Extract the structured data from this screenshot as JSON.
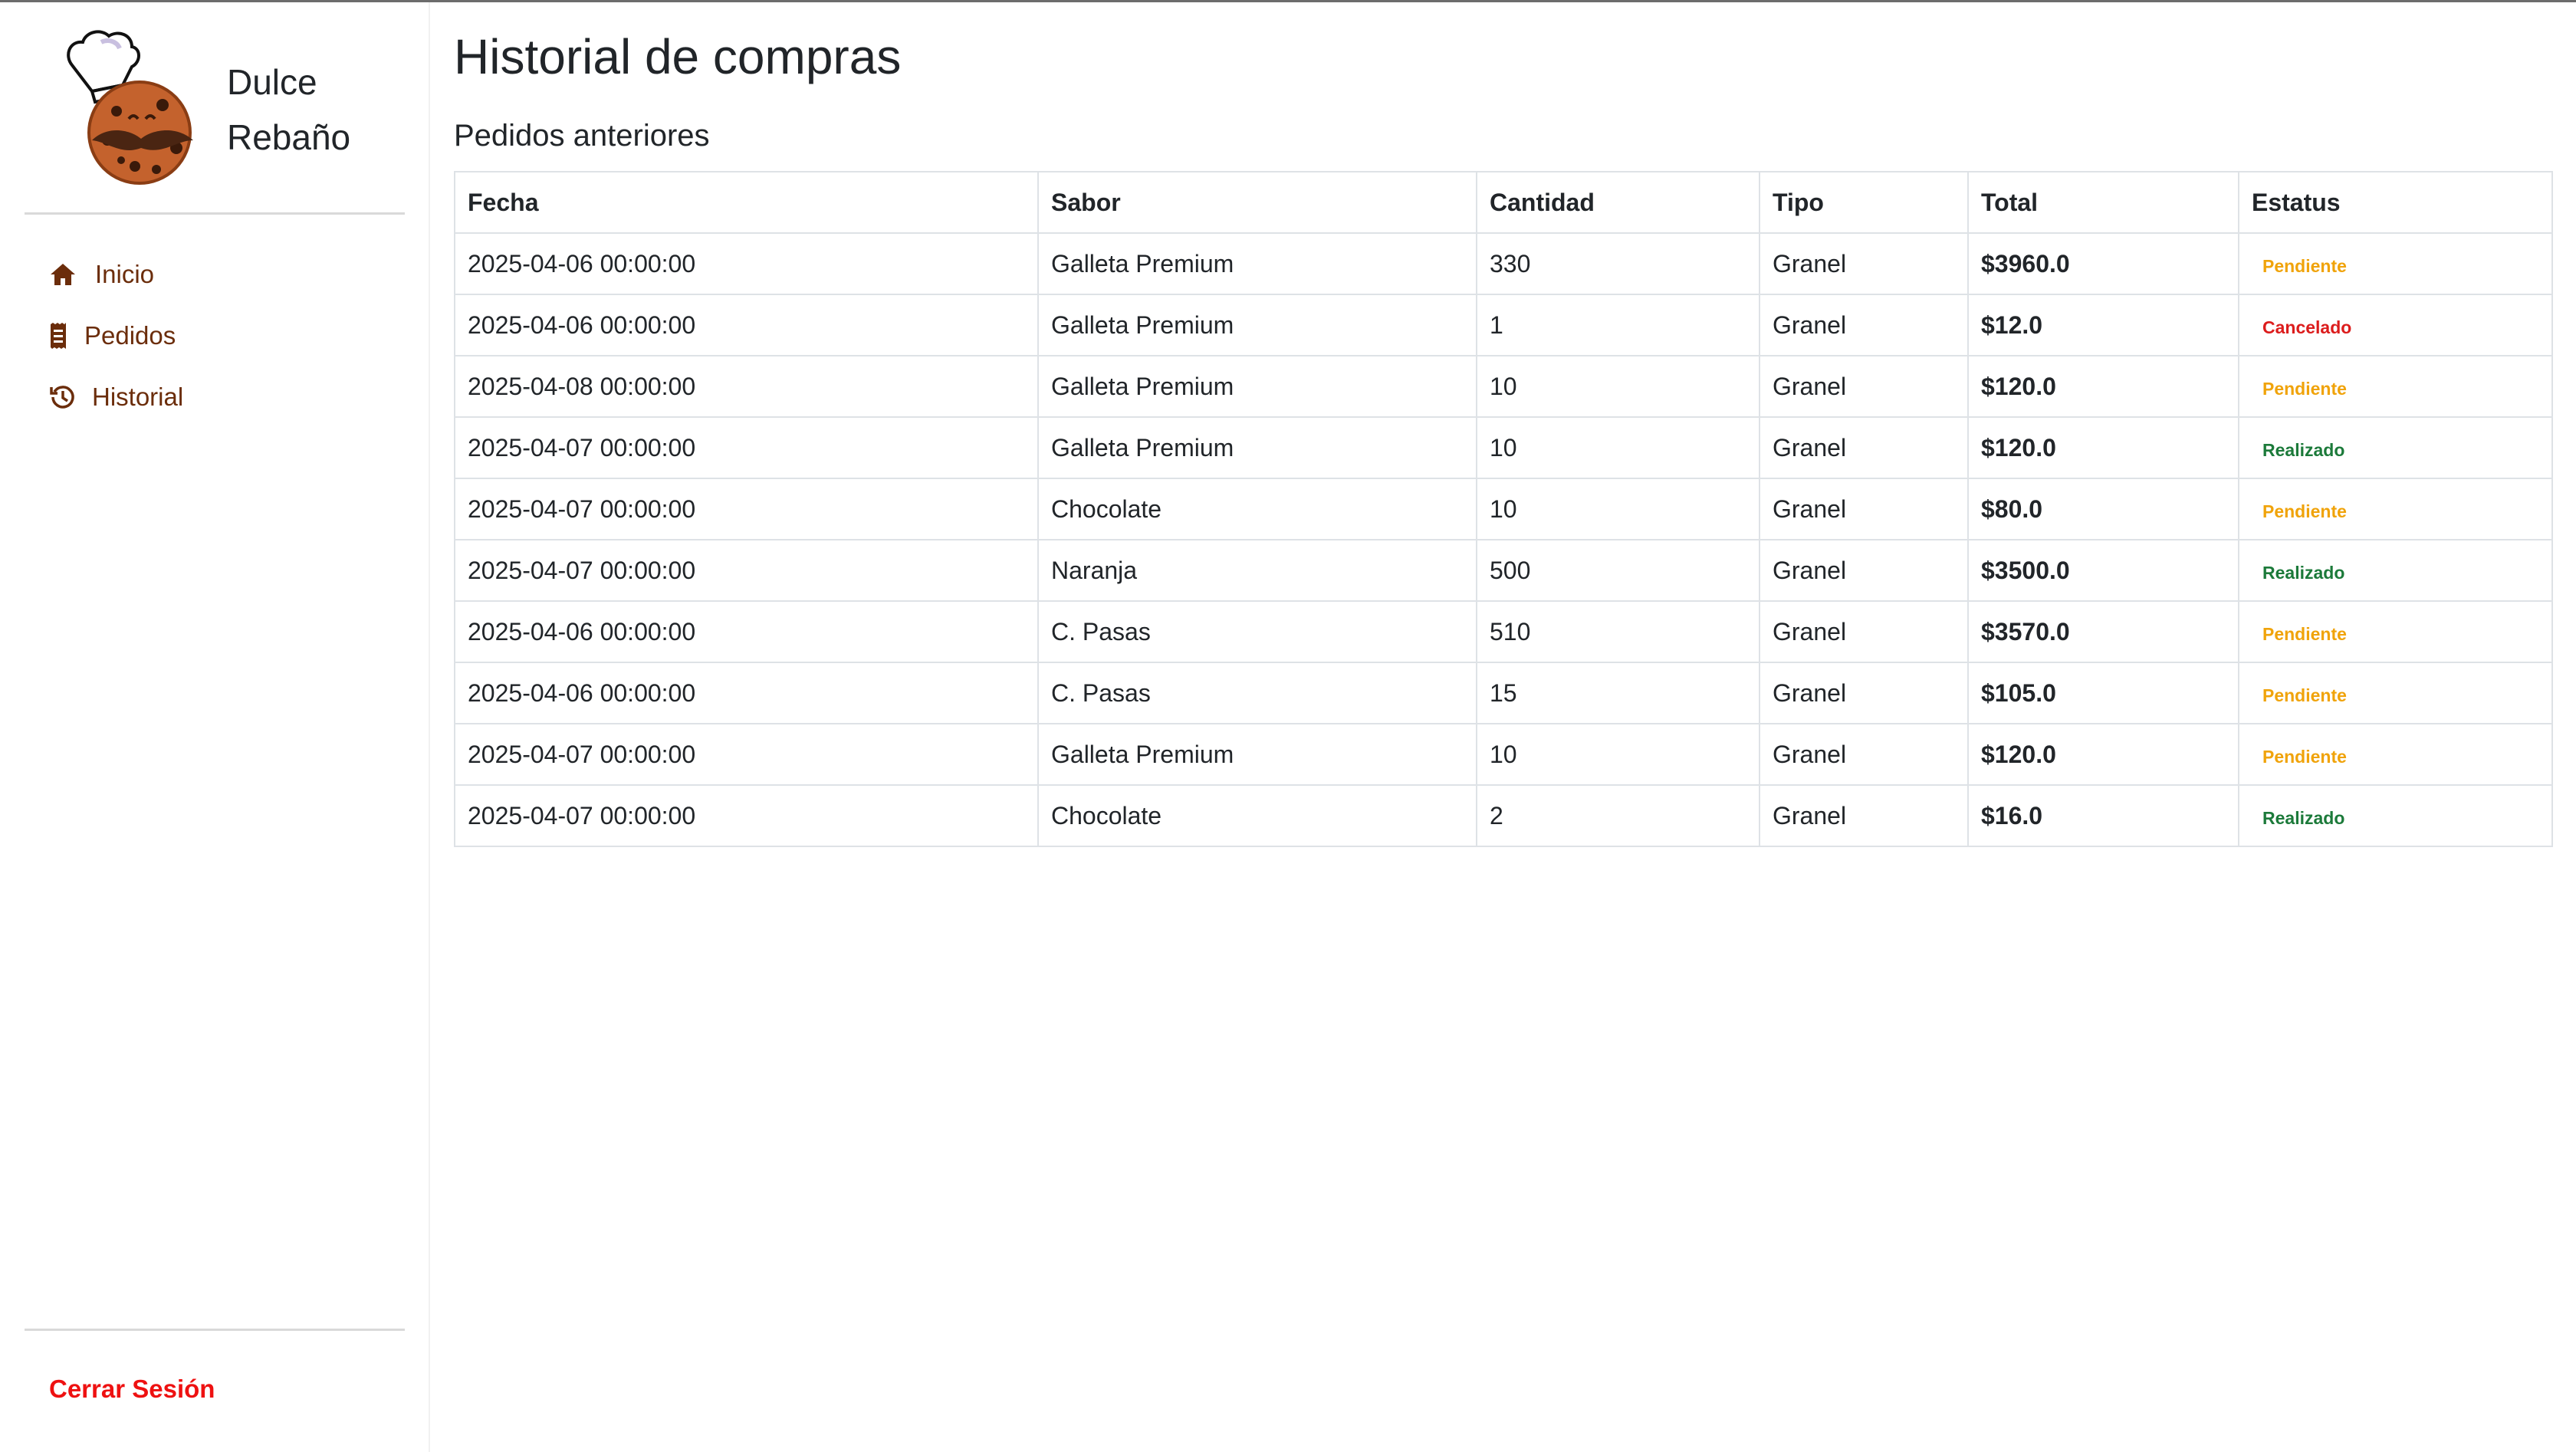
{
  "brand": {
    "name_line1": "Dulce",
    "name_line2": "Rebaño"
  },
  "sidebar": {
    "items": [
      {
        "label": "Inicio",
        "icon": "home-icon"
      },
      {
        "label": "Pedidos",
        "icon": "receipt-icon"
      },
      {
        "label": "Historial",
        "icon": "history-icon"
      }
    ],
    "logout_label": "Cerrar Sesión"
  },
  "main": {
    "title": "Historial de compras",
    "section_title": "Pedidos anteriores",
    "columns": [
      "Fecha",
      "Sabor",
      "Cantidad",
      "Tipo",
      "Total",
      "Estatus"
    ],
    "rows": [
      {
        "fecha": "2025-04-06 00:00:00",
        "sabor": "Galleta Premium",
        "cantidad": "330",
        "tipo": "Granel",
        "total": "$3960.0",
        "estatus": "Pendiente"
      },
      {
        "fecha": "2025-04-06 00:00:00",
        "sabor": "Galleta Premium",
        "cantidad": "1",
        "tipo": "Granel",
        "total": "$12.0",
        "estatus": "Cancelado"
      },
      {
        "fecha": "2025-04-08 00:00:00",
        "sabor": "Galleta Premium",
        "cantidad": "10",
        "tipo": "Granel",
        "total": "$120.0",
        "estatus": "Pendiente"
      },
      {
        "fecha": "2025-04-07 00:00:00",
        "sabor": "Galleta Premium",
        "cantidad": "10",
        "tipo": "Granel",
        "total": "$120.0",
        "estatus": "Realizado"
      },
      {
        "fecha": "2025-04-07 00:00:00",
        "sabor": "Chocolate",
        "cantidad": "10",
        "tipo": "Granel",
        "total": "$80.0",
        "estatus": "Pendiente"
      },
      {
        "fecha": "2025-04-07 00:00:00",
        "sabor": "Naranja",
        "cantidad": "500",
        "tipo": "Granel",
        "total": "$3500.0",
        "estatus": "Realizado"
      },
      {
        "fecha": "2025-04-06 00:00:00",
        "sabor": "C. Pasas",
        "cantidad": "510",
        "tipo": "Granel",
        "total": "$3570.0",
        "estatus": "Pendiente"
      },
      {
        "fecha": "2025-04-06 00:00:00",
        "sabor": "C. Pasas",
        "cantidad": "15",
        "tipo": "Granel",
        "total": "$105.0",
        "estatus": "Pendiente"
      },
      {
        "fecha": "2025-04-07 00:00:00",
        "sabor": "Galleta Premium",
        "cantidad": "10",
        "tipo": "Granel",
        "total": "$120.0",
        "estatus": "Pendiente"
      },
      {
        "fecha": "2025-04-07 00:00:00",
        "sabor": "Chocolate",
        "cantidad": "2",
        "tipo": "Granel",
        "total": "$16.0",
        "estatus": "Realizado"
      }
    ]
  },
  "colors": {
    "nav_text": "#6b2d0b",
    "logout": "#ee1111",
    "status_pendiente": "#f0a30a",
    "status_cancelado": "#dc1c1c",
    "status_realizado": "#1c7a3a"
  }
}
